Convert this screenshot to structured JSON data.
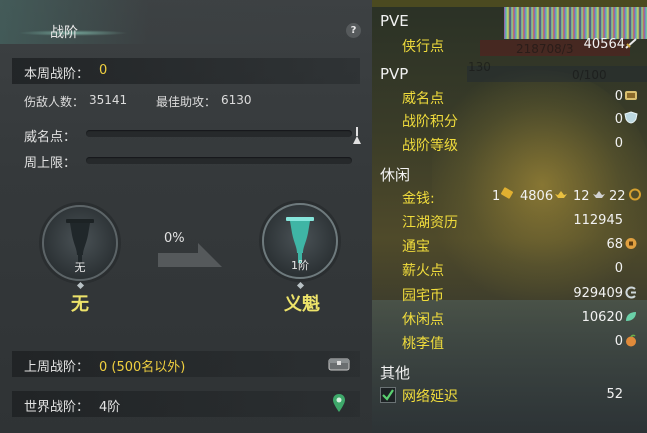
{
  "rank_panel": {
    "title": "战阶",
    "help": "?",
    "this_week_label": "本周战阶：",
    "this_week_value": "0",
    "kills_label": "伤敌人数：",
    "kills_value": "35141",
    "assist_label": "最佳助攻：",
    "assist_value": "6130",
    "prestige_label": "威名点：",
    "prestige_progress": 0,
    "week_cap_label": "周上限：",
    "week_cap_progress": 0,
    "current_rank": {
      "caption": "无",
      "name": "无"
    },
    "progress_percent": "0%",
    "next_rank": {
      "caption": "1阶",
      "name": "义魁"
    },
    "last_week_label": "上周战阶：",
    "last_week_value": "0 (500名以外)",
    "world_label": "世界战阶：",
    "world_value": "4阶"
  },
  "stats_panel": {
    "background_text": {
      "hp": "218708/3",
      "mp": "0/100",
      "level": "130"
    },
    "sections": {
      "pve": "PVE",
      "pvp": "PVP",
      "leisure": "休闲",
      "other": "其他"
    },
    "pve_items": [
      {
        "label": "侠行点",
        "value": "40564",
        "icon": "sword-icon"
      }
    ],
    "pvp_items": [
      {
        "label": "威名点",
        "value": "0",
        "icon": "scroll-icon"
      },
      {
        "label": "战阶积分",
        "value": "0",
        "icon": "shield-icon"
      },
      {
        "label": "战阶等级",
        "value": "0"
      }
    ],
    "money": {
      "label": "金钱:",
      "ingot": "1",
      "gold": "4806",
      "silver": "12",
      "copper": "22"
    },
    "leisure_items": [
      {
        "label": "江湖资历",
        "value": "112945"
      },
      {
        "label": "通宝",
        "value": "68",
        "icon": "coin-icon"
      },
      {
        "label": "薪火点",
        "value": "0"
      },
      {
        "label": "园宅币",
        "value": "929409",
        "icon": "house-coin-icon"
      },
      {
        "label": "休闲点",
        "value": "10620",
        "icon": "leaf-icon"
      },
      {
        "label": "桃李值",
        "value": "0",
        "icon": "peach-icon"
      }
    ],
    "other_items": [
      {
        "label": "网络延迟",
        "value": "52",
        "checked": true
      }
    ]
  },
  "colors": {
    "accent_yellow": "#f0dc3c",
    "rank_name": "#ede36a",
    "teal": "#3fb5a5"
  }
}
